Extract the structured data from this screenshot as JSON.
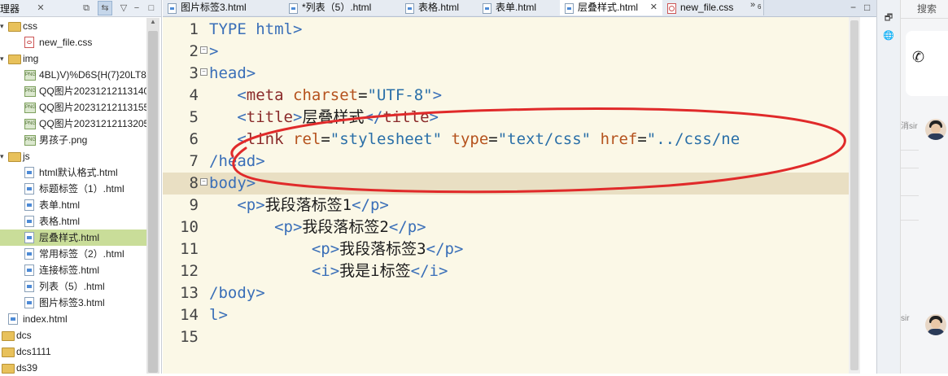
{
  "explorer": {
    "title": "理器",
    "close_glyph": "✕",
    "items": [
      {
        "label": "css",
        "kind": "folder",
        "depth": 0,
        "expanded": true
      },
      {
        "label": "new_file.css",
        "kind": "css",
        "depth": 1
      },
      {
        "label": "img",
        "kind": "folder",
        "depth": 0,
        "expanded": true
      },
      {
        "label": "4BL)V)%D6S{H(7}20LT8",
        "kind": "png",
        "depth": 1
      },
      {
        "label": "QQ图片20231212113140",
        "kind": "png",
        "depth": 1
      },
      {
        "label": "QQ图片20231212113155",
        "kind": "png",
        "depth": 1
      },
      {
        "label": "QQ图片20231212113205",
        "kind": "png",
        "depth": 1
      },
      {
        "label": "男孩子.png",
        "kind": "png",
        "depth": 1
      },
      {
        "label": "js",
        "kind": "folder",
        "depth": 0,
        "expanded": true
      },
      {
        "label": "html默认格式.html",
        "kind": "html",
        "depth": 1
      },
      {
        "label": "标题标签（1）.html",
        "kind": "html",
        "depth": 1
      },
      {
        "label": "表单.html",
        "kind": "html",
        "depth": 1
      },
      {
        "label": "表格.html",
        "kind": "html",
        "depth": 1
      },
      {
        "label": "层叠样式.html",
        "kind": "html",
        "depth": 1,
        "selected": true
      },
      {
        "label": "常用标签（2）.html",
        "kind": "html",
        "depth": 1
      },
      {
        "label": "连接标签.html",
        "kind": "html",
        "depth": 1
      },
      {
        "label": "列表（5）.html",
        "kind": "html",
        "depth": 1
      },
      {
        "label": "图片标签3.html",
        "kind": "html",
        "depth": 1
      },
      {
        "label": "index.html",
        "kind": "html",
        "depth": 0
      },
      {
        "label": "dcs",
        "kind": "project",
        "depth": -1
      },
      {
        "label": "dcs1111",
        "kind": "project",
        "depth": -1
      },
      {
        "label": "ds39",
        "kind": "project",
        "depth": -1
      }
    ]
  },
  "tabs": [
    {
      "label": "图片标签3.html",
      "kind": "html"
    },
    {
      "label": "*列表（5）.html",
      "kind": "html"
    },
    {
      "label": "表格.html",
      "kind": "html"
    },
    {
      "label": "表单.html",
      "kind": "html"
    },
    {
      "label": "层叠样式.html",
      "kind": "html",
      "active": true,
      "close": "✕"
    },
    {
      "label": "new_file.css",
      "kind": "css"
    }
  ],
  "tab_overflow": {
    "glyph": "»",
    "count": "6"
  },
  "editor": {
    "current_line": 8,
    "lines": [
      {
        "num": "1",
        "fold": false,
        "indent": "",
        "tokens": [
          [
            "t",
            "TYPE html>"
          ]
        ]
      },
      {
        "num": "2",
        "fold": true,
        "indent": "",
        "tokens": [
          [
            "t",
            ">"
          ]
        ]
      },
      {
        "num": "3",
        "fold": true,
        "indent": "",
        "tokens": [
          [
            "t",
            "head>"
          ]
        ]
      },
      {
        "num": "4",
        "fold": false,
        "indent": "   ",
        "tokens": [
          [
            "t",
            "<"
          ],
          [
            "tg",
            "meta"
          ],
          [
            "tx",
            " "
          ],
          [
            "at",
            "charset"
          ],
          [
            "tx",
            "="
          ],
          [
            "av",
            "\"UTF-8\""
          ],
          [
            "t",
            ">"
          ]
        ]
      },
      {
        "num": "5",
        "fold": false,
        "indent": "   ",
        "tokens": [
          [
            "t",
            "<"
          ],
          [
            "tg",
            "title"
          ],
          [
            "t",
            ">"
          ],
          [
            "tx",
            "层叠样式"
          ],
          [
            "t",
            "</"
          ],
          [
            "tg",
            "title"
          ],
          [
            "t",
            ">"
          ]
        ]
      },
      {
        "num": "6",
        "fold": false,
        "indent": "   ",
        "tokens": [
          [
            "t",
            "<"
          ],
          [
            "tg",
            "link"
          ],
          [
            "tx",
            " "
          ],
          [
            "at",
            "rel"
          ],
          [
            "tx",
            "="
          ],
          [
            "av",
            "\"stylesheet\""
          ],
          [
            "tx",
            " "
          ],
          [
            "at",
            "type"
          ],
          [
            "tx",
            "="
          ],
          [
            "av",
            "\"text/css\""
          ],
          [
            "tx",
            " "
          ],
          [
            "at",
            "href"
          ],
          [
            "tx",
            "="
          ],
          [
            "av",
            "\"../css/ne"
          ]
        ]
      },
      {
        "num": "7",
        "fold": false,
        "indent": "",
        "tokens": [
          [
            "t",
            "/head>"
          ]
        ]
      },
      {
        "num": "8",
        "fold": true,
        "indent": "",
        "tokens": [
          [
            "t",
            "body>"
          ]
        ]
      },
      {
        "num": "9",
        "fold": false,
        "indent": "   ",
        "tokens": [
          [
            "t",
            "<p>"
          ],
          [
            "tx",
            "我段落标签1"
          ],
          [
            "t",
            "</p>"
          ]
        ]
      },
      {
        "num": "10",
        "fold": false,
        "indent": "       ",
        "tokens": [
          [
            "t",
            "<p>"
          ],
          [
            "tx",
            "我段落标签2"
          ],
          [
            "t",
            "</p>"
          ]
        ]
      },
      {
        "num": "11",
        "fold": false,
        "indent": "           ",
        "tokens": [
          [
            "t",
            "<p>"
          ],
          [
            "tx",
            "我段落标签3"
          ],
          [
            "t",
            "</p>"
          ]
        ]
      },
      {
        "num": "12",
        "fold": false,
        "indent": "           ",
        "tokens": [
          [
            "t",
            "<i>"
          ],
          [
            "tx",
            "我是i标签"
          ],
          [
            "t",
            "</i>"
          ]
        ]
      },
      {
        "num": "13",
        "fold": false,
        "indent": "",
        "tokens": [
          [
            "t",
            "/body>"
          ]
        ]
      },
      {
        "num": "14",
        "fold": false,
        "indent": "",
        "tokens": [
          [
            "t",
            "l>"
          ]
        ]
      },
      {
        "num": "15",
        "fold": false,
        "indent": "",
        "tokens": []
      }
    ]
  },
  "side_toolbar": {
    "restore_glyph": "🗗",
    "globe_glyph": "🌐"
  },
  "chat": {
    "search_label": "搜索",
    "phone_glyph": "✆",
    "fragment_top": "消sir",
    "fragment_bottom": "sir"
  },
  "annotation": {
    "color": "#e02a2a"
  }
}
